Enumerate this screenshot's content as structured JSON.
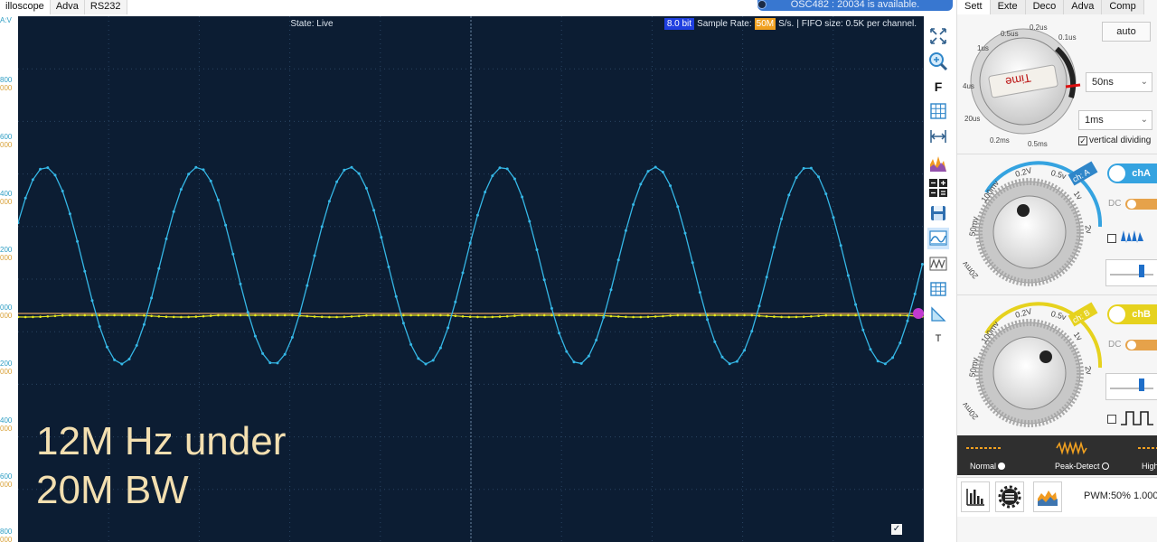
{
  "top_tabs": [
    "illoscope",
    "Adva",
    "RS232"
  ],
  "y_axis": {
    "unit": "A:V",
    "ticks": [
      {
        "v": "800",
        "s": "000"
      },
      {
        "v": "600",
        "s": "000"
      },
      {
        "v": "400",
        "s": "000"
      },
      {
        "v": "200",
        "s": "000"
      },
      {
        "v": "000",
        "s": "000"
      },
      {
        "v": "200",
        "s": "000"
      },
      {
        "v": "400",
        "s": "000"
      },
      {
        "v": "600",
        "s": "000"
      },
      {
        "v": "800",
        "s": "000"
      }
    ]
  },
  "screen": {
    "state": "State: Live",
    "bit_depth": "8.0 bit",
    "sample_rate_label": "Sample Rate:",
    "sample_rate_value": "50M",
    "sample_rate_unit": "S/s.",
    "fifo": "| FIFO size: 0.5K per channel.",
    "overlay_line1": "12M Hz under",
    "overlay_line2": "20M BW",
    "checkbox_mark": "✓"
  },
  "update_notice": "OSC482 : 20034 is available.",
  "toolbar_icons": [
    "fit-icon",
    "zoom-icon",
    "f-icon",
    "grid-icon",
    "measure-icon",
    "spectrum-icon",
    "math-icon",
    "save-icon",
    "display-icon",
    "wave-icon",
    "table-icon",
    "cursor-icon",
    "text-icon"
  ],
  "toolbar_text": {
    "f": "F",
    "t": "T"
  },
  "right_panel": {
    "tabs": [
      "Sett",
      "Exte",
      "Deco",
      "Adva",
      "Comp"
    ],
    "auto_label": "auto",
    "time_dial_label": "Time",
    "time_dial_marks": [
      "0.5us",
      "0.2us",
      "0.1us",
      "1us",
      "4us",
      "20us",
      "0.2ms",
      "0.5ms"
    ],
    "timebase": "50ns",
    "timebase2": "1ms",
    "vertical_dividing": "vertical dividing",
    "channel_a": {
      "name": "chA",
      "tag": "ch: A",
      "coupling": "DC",
      "marks": [
        "50mv",
        "100mv",
        "0.2V",
        "0.5v",
        "1v",
        "2v",
        "20mv"
      ]
    },
    "channel_b": {
      "name": "chB",
      "tag": "ch: B",
      "coupling": "DC",
      "marks": [
        "50mv",
        "100mv",
        "0.2V",
        "0.5v",
        "1v",
        "2v",
        "20mv"
      ]
    },
    "modes": [
      {
        "label": "Normal",
        "selected": true
      },
      {
        "label": "Peak-Detect",
        "selected": false
      },
      {
        "label": "High",
        "selected": false
      }
    ],
    "pwm": "PWM:50% 1.000"
  },
  "colors": {
    "screen_bg": "#0c1d33",
    "channel_a": "#35b7e6",
    "channel_b": "#e6e61e",
    "accent_orange": "#f0a020"
  },
  "chart_data": {
    "type": "line",
    "series": [
      {
        "shape": "sine",
        "frequency_hz": 12000000,
        "cycles_visible": 6,
        "color": "#35b7e6"
      },
      {
        "shape": "flat",
        "color": "#e6e61e"
      }
    ]
  }
}
